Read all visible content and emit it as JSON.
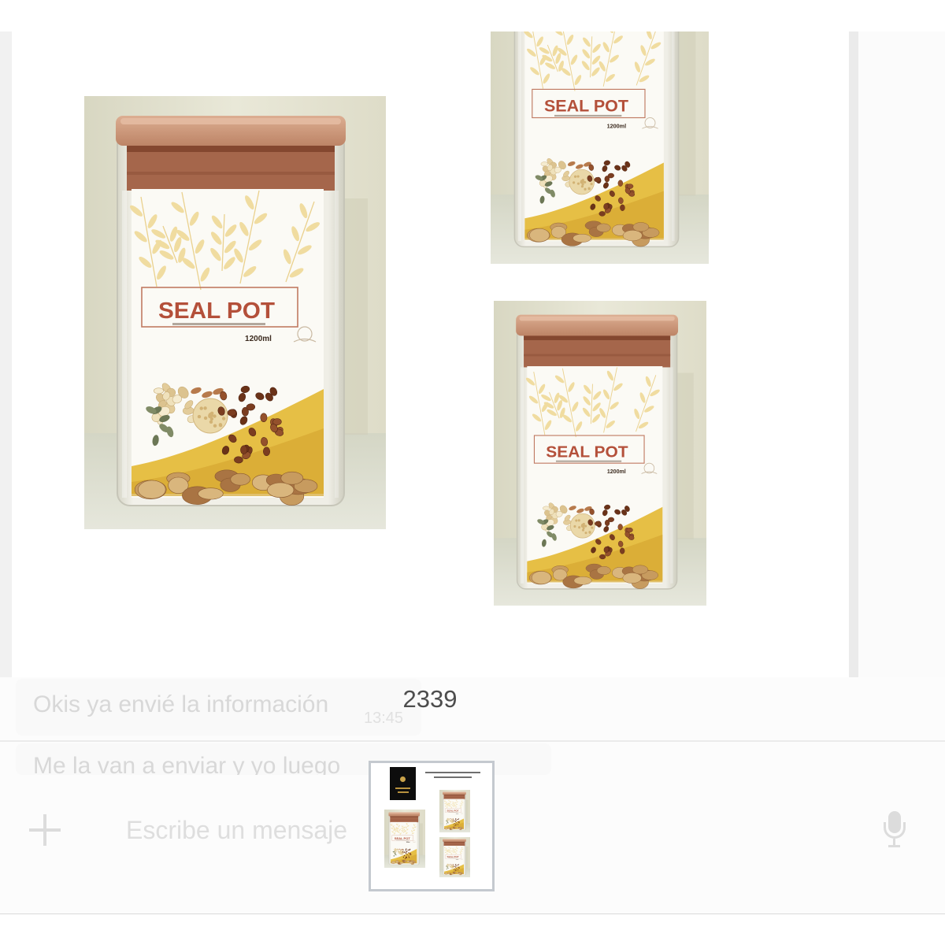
{
  "viewer": {
    "caption": "2339"
  },
  "product": {
    "label_title": "SEAL POT",
    "label_volume": "1200ml"
  },
  "chat": {
    "messages": [
      {
        "text": "Okis ya envié la información",
        "time": "13:45"
      },
      {
        "text": "Me la van a enviar y yo luego"
      }
    ]
  },
  "composer": {
    "placeholder": "Escribe un mensaje"
  },
  "icons": {
    "attach": "plus-icon",
    "voice": "microphone-icon"
  },
  "colors": {
    "caption_text": "#4d4d4d",
    "faded_text": "#d8d8d8",
    "label_title": "#b4503a",
    "jar_lid": "#c89478",
    "label_swoosh": "#e6bf45",
    "thumbnail_border": "#c4c9cf"
  }
}
